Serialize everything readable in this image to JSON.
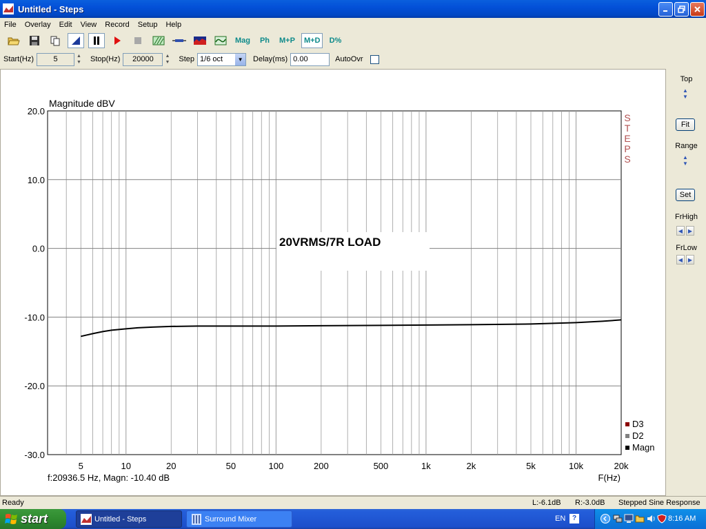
{
  "window": {
    "title": "Untitled - Steps"
  },
  "menu": [
    "File",
    "Overlay",
    "Edit",
    "View",
    "Record",
    "Setup",
    "Help"
  ],
  "toolbar": {
    "mag": "Mag",
    "ph": "Ph",
    "mp": "M+P",
    "md": "M+D",
    "dpct": "D%"
  },
  "params": {
    "start_label": "Start(Hz)",
    "start_value": "5",
    "stop_label": "Stop(Hz)",
    "stop_value": "20000",
    "step_label": "Step",
    "step_value": "1/6 oct",
    "delay_label": "Delay(ms)",
    "delay_value": "0.00",
    "autoovr_label": "AutoOvr"
  },
  "right_panel": {
    "top": "Top",
    "fit": "Fit",
    "range": "Range",
    "set": "Set",
    "frhigh": "FrHigh",
    "frlow": "FrLow"
  },
  "chart_data": {
    "type": "line",
    "ylabel": "Magnitude dBV",
    "xlabel": "F(Hz)",
    "x_scale": "log",
    "xlim": [
      3,
      20000
    ],
    "ylim": [
      -30,
      20
    ],
    "y_ticks": [
      20,
      10,
      0,
      -10,
      -20,
      -30
    ],
    "y_tick_labels": [
      "20.0",
      "10.0",
      "0.0",
      "-10.0",
      "-20.0",
      "-30.0"
    ],
    "x_ticks": [
      5,
      10,
      20,
      50,
      100,
      200,
      500,
      1000,
      2000,
      5000,
      10000,
      20000
    ],
    "x_tick_labels": [
      "5",
      "10",
      "20",
      "50",
      "100",
      "200",
      "500",
      "1k",
      "2k",
      "5k",
      "10k",
      "20k"
    ],
    "annotation": "20VRMS/7R LOAD",
    "side_text": "STEPS",
    "grid": true,
    "legend_position": "bottom-right",
    "legend": [
      {
        "name": "D3",
        "color": "#8b0000"
      },
      {
        "name": "D2",
        "color": "#808080"
      },
      {
        "name": "Magn",
        "color": "#000000"
      }
    ],
    "cursor_readout": "f:20936.5 Hz, Magn: -10.40 dB",
    "series": [
      {
        "name": "Magn",
        "color": "#000000",
        "x": [
          5,
          6,
          7,
          8,
          10,
          12,
          15,
          20,
          30,
          50,
          100,
          200,
          500,
          1000,
          2000,
          5000,
          10000,
          15000,
          20000
        ],
        "y": [
          -12.8,
          -12.4,
          -12.1,
          -11.9,
          -11.7,
          -11.55,
          -11.45,
          -11.35,
          -11.3,
          -11.3,
          -11.3,
          -11.25,
          -11.2,
          -11.15,
          -11.1,
          -11.0,
          -10.8,
          -10.6,
          -10.4
        ]
      }
    ]
  },
  "status": {
    "ready": "Ready",
    "left": "L:-6.1dB",
    "right": "R:-3.0dB",
    "mode": "Stepped Sine Response"
  },
  "taskbar": {
    "start": "start",
    "task1": "Untitled - Steps",
    "task2": "Surround Mixer",
    "lang": "EN",
    "time": "8:16 AM"
  },
  "colors": {
    "plot_bg": "#ffffff",
    "grid": "#a0a0a0",
    "accent_teal": "#0d8a8a",
    "steps_text": "#b05050"
  }
}
